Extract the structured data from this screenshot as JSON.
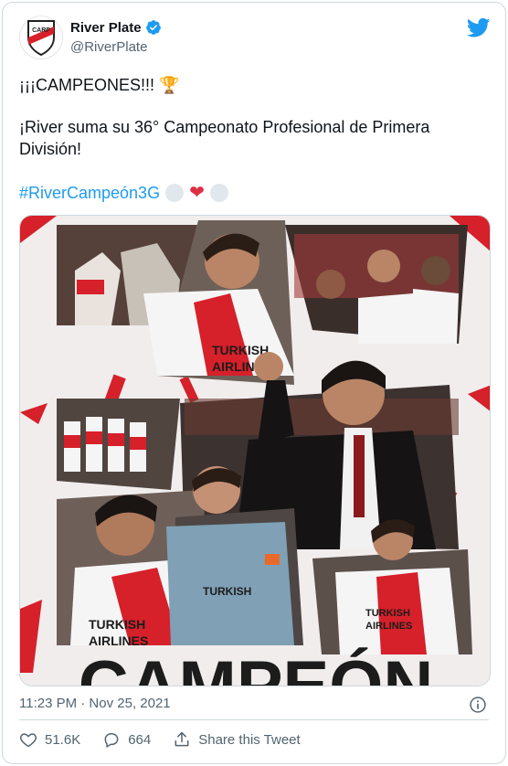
{
  "account": {
    "name": "River Plate",
    "handle": "@RiverPlate",
    "avatar_initials": "CARP"
  },
  "tweet": {
    "line1": "¡¡¡CAMPEONES!!! 🏆",
    "line2": "¡River suma su 36° Campeonato Profesional de Primera",
    "line3": "División!",
    "hashtag": "#RiverCampeón3G"
  },
  "media": {
    "sponsor_text_1": "TURKISH",
    "sponsor_text_2": "AIRLINES",
    "banner_text": "CAMPEÓN"
  },
  "meta": {
    "timestamp": "11:23 PM · Nov 25, 2021"
  },
  "actions": {
    "likes": "51.6K",
    "replies": "664",
    "share_label": "Share this Tweet"
  },
  "colors": {
    "link": "#1d9bf0",
    "river_red": "#d6202a",
    "secondary_text": "#536471"
  }
}
